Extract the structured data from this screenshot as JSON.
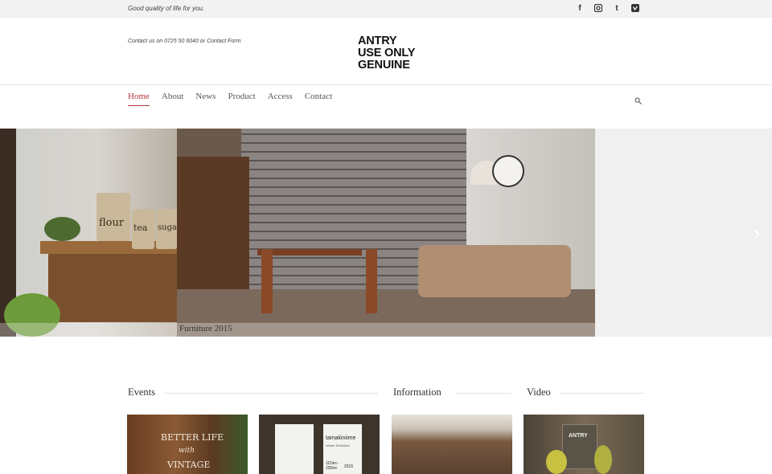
{
  "topbar": {
    "tagline": "Good quality of life for you.",
    "social": [
      {
        "icon": "facebook-icon",
        "glyph": "f"
      },
      {
        "icon": "instagram-icon",
        "glyph": "◙"
      },
      {
        "icon": "tumblr-icon",
        "glyph": "t"
      },
      {
        "icon": "vimeo-icon",
        "glyph": "v"
      }
    ]
  },
  "header": {
    "contact": "Contact us on 0725 50 6040 or Contact Form",
    "logo_lines": [
      "ANTRY",
      "USE ONLY",
      "GENUINE"
    ]
  },
  "nav": {
    "items": [
      "Home",
      "About",
      "News",
      "Product",
      "Access",
      "Contact"
    ],
    "active": "Home",
    "search_icon": "search-icon"
  },
  "slider": {
    "caption": "Furniture 2015",
    "next_icon": "chevron-right-icon",
    "next_glyph": "›",
    "jar_labels": [
      "flour",
      "tea",
      "sugar"
    ]
  },
  "sections": {
    "events": "Events",
    "information": "Information",
    "video": "Video"
  },
  "thumbs": {
    "t1_text_1": "BETTER LIFE",
    "t1_text_2": "with",
    "t1_text_3": "VINTAGE",
    "t2_poster": "tamakiniime",
    "t2_sub": "Winter Exhibition",
    "t2_date_1": "11Dec-",
    "t2_date_2": "29Dec",
    "t2_year": "2015",
    "t4_sign": "ANTRY"
  },
  "colors": {
    "accent": "#b0343a",
    "topbar_bg": "#f2f2f2"
  }
}
